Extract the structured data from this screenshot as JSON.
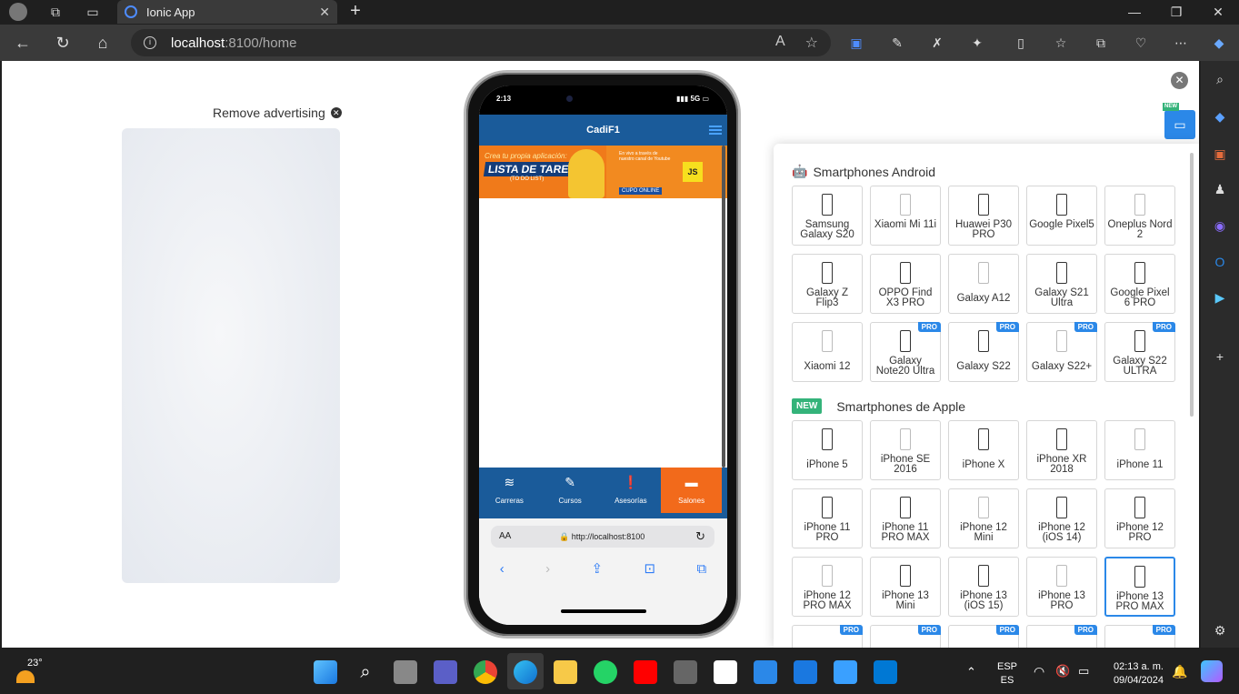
{
  "browser": {
    "tab_title": "Ionic App",
    "url_host": "localhost",
    "url_path": ":8100/home"
  },
  "ad": {
    "remove_label": "Remove advertising"
  },
  "phone": {
    "time": "2:13",
    "signal": "5G",
    "app_title": "CadiF1",
    "banner": {
      "line1": "Crea tu propia aplicación:",
      "line2": "LISTA DE TAREAS",
      "line3": "(TO DO LIST)",
      "promo": "En vivo a través de nuestro canal de Youtube",
      "badge": "JS",
      "cupo": "CUPO ONLINE"
    },
    "tabs": [
      {
        "label": "Carreras",
        "icon": "layers-icon"
      },
      {
        "label": "Cursos",
        "icon": "edit-icon"
      },
      {
        "label": "Asesorías",
        "icon": "alert-icon"
      },
      {
        "label": "Salones",
        "icon": "briefcase-icon"
      }
    ],
    "safari_aa": "AA",
    "safari_url": "http://localhost:8100"
  },
  "devices": {
    "android_title": "Smartphones Android",
    "apple_title": "Smartphones de Apple",
    "new_label": "NEW",
    "pro_label": "PRO",
    "android": [
      {
        "name": "Samsung Galaxy S20",
        "pro": false
      },
      {
        "name": "Xiaomi Mi 11i",
        "pro": false
      },
      {
        "name": "Huawei P30 PRO",
        "pro": false
      },
      {
        "name": "Google Pixel5",
        "pro": false
      },
      {
        "name": "Oneplus Nord 2",
        "pro": false
      },
      {
        "name": "Galaxy Z Flip3",
        "pro": false
      },
      {
        "name": "OPPO Find X3 PRO",
        "pro": false
      },
      {
        "name": "Galaxy A12",
        "pro": false
      },
      {
        "name": "Galaxy S21 Ultra",
        "pro": false
      },
      {
        "name": "Google Pixel 6 PRO",
        "pro": false
      },
      {
        "name": "Xiaomi 12",
        "pro": false
      },
      {
        "name": "Galaxy Note20 Ultra",
        "pro": true
      },
      {
        "name": "Galaxy S22",
        "pro": true
      },
      {
        "name": "Galaxy S22+",
        "pro": true
      },
      {
        "name": "Galaxy S22 ULTRA",
        "pro": true
      }
    ],
    "apple": [
      {
        "name": "iPhone 5",
        "pro": false
      },
      {
        "name": "iPhone SE 2016",
        "pro": false
      },
      {
        "name": "iPhone X",
        "pro": false
      },
      {
        "name": "iPhone XR 2018",
        "pro": false
      },
      {
        "name": "iPhone 11",
        "pro": false
      },
      {
        "name": "iPhone 11 PRO",
        "pro": false
      },
      {
        "name": "iPhone 11 PRO MAX",
        "pro": false
      },
      {
        "name": "iPhone 12 Mini",
        "pro": false
      },
      {
        "name": "iPhone 12 (iOS 14)",
        "pro": false
      },
      {
        "name": "iPhone 12 PRO",
        "pro": false
      },
      {
        "name": "iPhone 12 PRO MAX",
        "pro": false
      },
      {
        "name": "iPhone 13 Mini",
        "pro": false
      },
      {
        "name": "iPhone 13 (iOS 15)",
        "pro": false
      },
      {
        "name": "iPhone 13 PRO",
        "pro": false
      },
      {
        "name": "iPhone 13 PRO MAX",
        "pro": false,
        "selected": true
      }
    ]
  },
  "taskbar": {
    "temp": "23°",
    "lang1": "ESP",
    "lang2": "ES",
    "time": "02:13 a. m.",
    "date": "09/04/2024"
  },
  "colors": {
    "accent": "#2b88e8",
    "app_header": "#1a5b9a",
    "tab_active": "#f26a1b",
    "new_green": "#34b37a"
  }
}
